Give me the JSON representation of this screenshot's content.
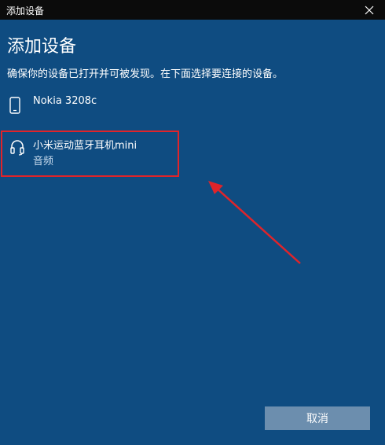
{
  "window": {
    "title": "添加设备"
  },
  "main": {
    "heading": "添加设备",
    "description": "确保你的设备已打开并可被发现。在下面选择要连接的设备。",
    "devices": [
      {
        "name": "Nokia 3208c",
        "type": "",
        "icon": "phone-icon"
      },
      {
        "name": "小米运动蓝牙耳机mini",
        "type": "音频",
        "icon": "headset-icon"
      }
    ]
  },
  "footer": {
    "cancel_label": "取消"
  },
  "colors": {
    "background": "#0f4c81",
    "titlebar": "#0b0b0b",
    "annotation": "#e0242a",
    "cancel_button": "#6c8eae"
  }
}
